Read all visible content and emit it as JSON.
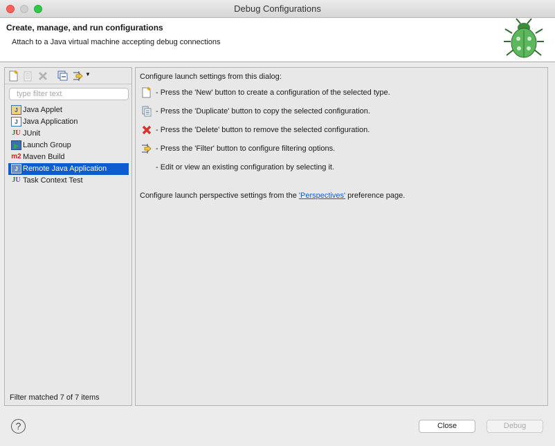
{
  "window": {
    "title": "Debug Configurations"
  },
  "header": {
    "title": "Create, manage, and run configurations",
    "subtitle": "Attach to a Java virtual machine accepting debug connections"
  },
  "left": {
    "filter_placeholder": "type filter text",
    "items": [
      {
        "label": "Java Applet",
        "icon": "java-applet-icon"
      },
      {
        "label": "Java Application",
        "icon": "java-application-icon"
      },
      {
        "label": "JUnit",
        "icon": "junit-icon"
      },
      {
        "label": "Launch Group",
        "icon": "launch-group-icon"
      },
      {
        "label": "Maven Build",
        "icon": "maven-icon"
      },
      {
        "label": "Remote Java Application",
        "icon": "remote-java-icon",
        "selected": true
      },
      {
        "label": "Task Context Test",
        "icon": "task-context-icon"
      }
    ],
    "status": "Filter matched 7 of 7 items"
  },
  "right": {
    "intro": "Configure launch settings from this dialog:",
    "lines": [
      "- Press the 'New' button to create a configuration of the selected type.",
      "- Press the 'Duplicate' button to copy the selected configuration.",
      "- Press the 'Delete' button to remove the selected configuration.",
      "- Press the 'Filter' button to configure filtering options.",
      "- Edit or view an existing configuration by selecting it."
    ],
    "persp_prefix": "Configure launch perspective settings from the ",
    "persp_link": "'Perspectives'",
    "persp_suffix": " preference page."
  },
  "footer": {
    "help": "?",
    "close": "Close",
    "debug": "Debug"
  },
  "colors": {
    "selection": "#0f5bd0",
    "link": "#0b5fd6"
  }
}
